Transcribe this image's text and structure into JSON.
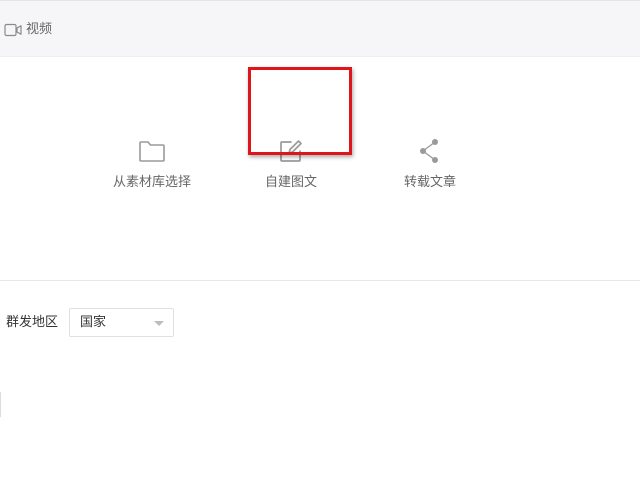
{
  "tabs": {
    "video_label": "视频",
    "video_icon": "video-camera-icon"
  },
  "actions": {
    "library": {
      "label": "从素材库选择",
      "icon": "folder-icon"
    },
    "create": {
      "label": "自建图文",
      "icon": "edit-icon"
    },
    "repost": {
      "label": "转载文章",
      "icon": "share-icon"
    }
  },
  "region": {
    "label": "群发地区",
    "selected": "国家"
  },
  "colors": {
    "highlight": "#e0141b",
    "icon_gray": "#9a9a9a",
    "tab_bg": "#f6f6f8"
  }
}
